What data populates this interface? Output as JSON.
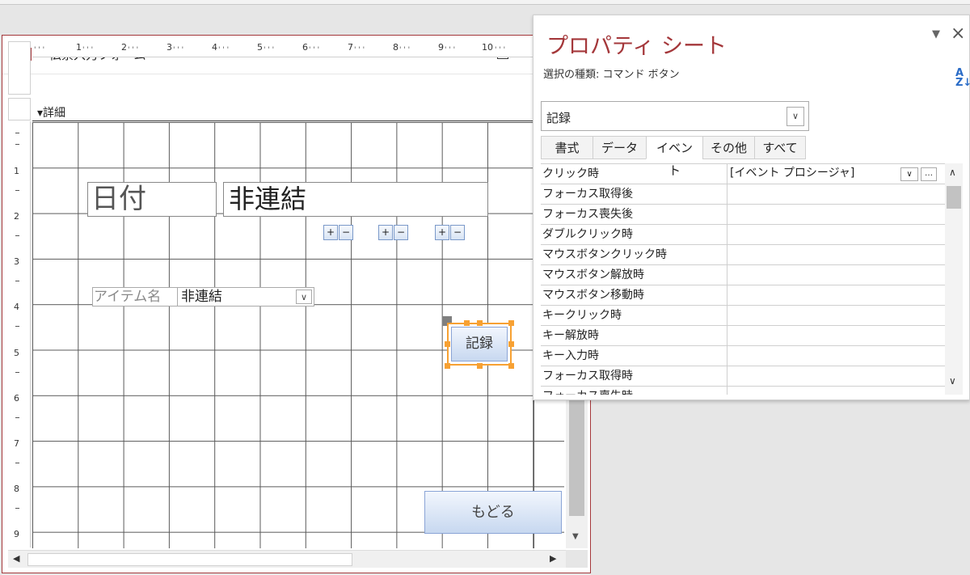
{
  "form": {
    "title": "伝票入力フォーム",
    "section_label": "詳細",
    "ruler_h": [
      "1",
      "2",
      "3",
      "4",
      "5",
      "6",
      "7",
      "8",
      "9",
      "10"
    ],
    "ruler_v": [
      "1",
      "2",
      "3",
      "4",
      "5",
      "6",
      "7",
      "8",
      "9"
    ],
    "label_date": "日付",
    "text_date": "非連結",
    "plus": "+",
    "minus": "−",
    "label_item": "アイテム名",
    "combo_item": "非連結",
    "button_record": "記録",
    "button_back": "もどる"
  },
  "property_sheet": {
    "title": "プロパティ シート",
    "selection_type": "選択の種類: コマンド ボタン",
    "selected_control": "記録",
    "tabs": [
      "書式",
      "データ",
      "イベント",
      "その他",
      "すべて"
    ],
    "active_tab": "イベント",
    "rows": [
      {
        "name": "クリック時",
        "value": "[イベント プロシージャ]"
      },
      {
        "name": "フォーカス取得後",
        "value": ""
      },
      {
        "name": "フォーカス喪失後",
        "value": ""
      },
      {
        "name": "ダブルクリック時",
        "value": ""
      },
      {
        "name": "マウスボタンクリック時",
        "value": ""
      },
      {
        "name": "マウスボタン解放時",
        "value": ""
      },
      {
        "name": "マウスボタン移動時",
        "value": ""
      },
      {
        "name": "キークリック時",
        "value": ""
      },
      {
        "name": "キー解放時",
        "value": ""
      },
      {
        "name": "キー入力時",
        "value": ""
      },
      {
        "name": "フォーカス取得時",
        "value": ""
      },
      {
        "name": "フォーカス喪失時",
        "value": ""
      }
    ]
  },
  "icons": {
    "form": "form-view-icon",
    "sort": "sort-az-icon",
    "dropdown": "chevron-down-icon",
    "build": "ellipsis-icon"
  }
}
